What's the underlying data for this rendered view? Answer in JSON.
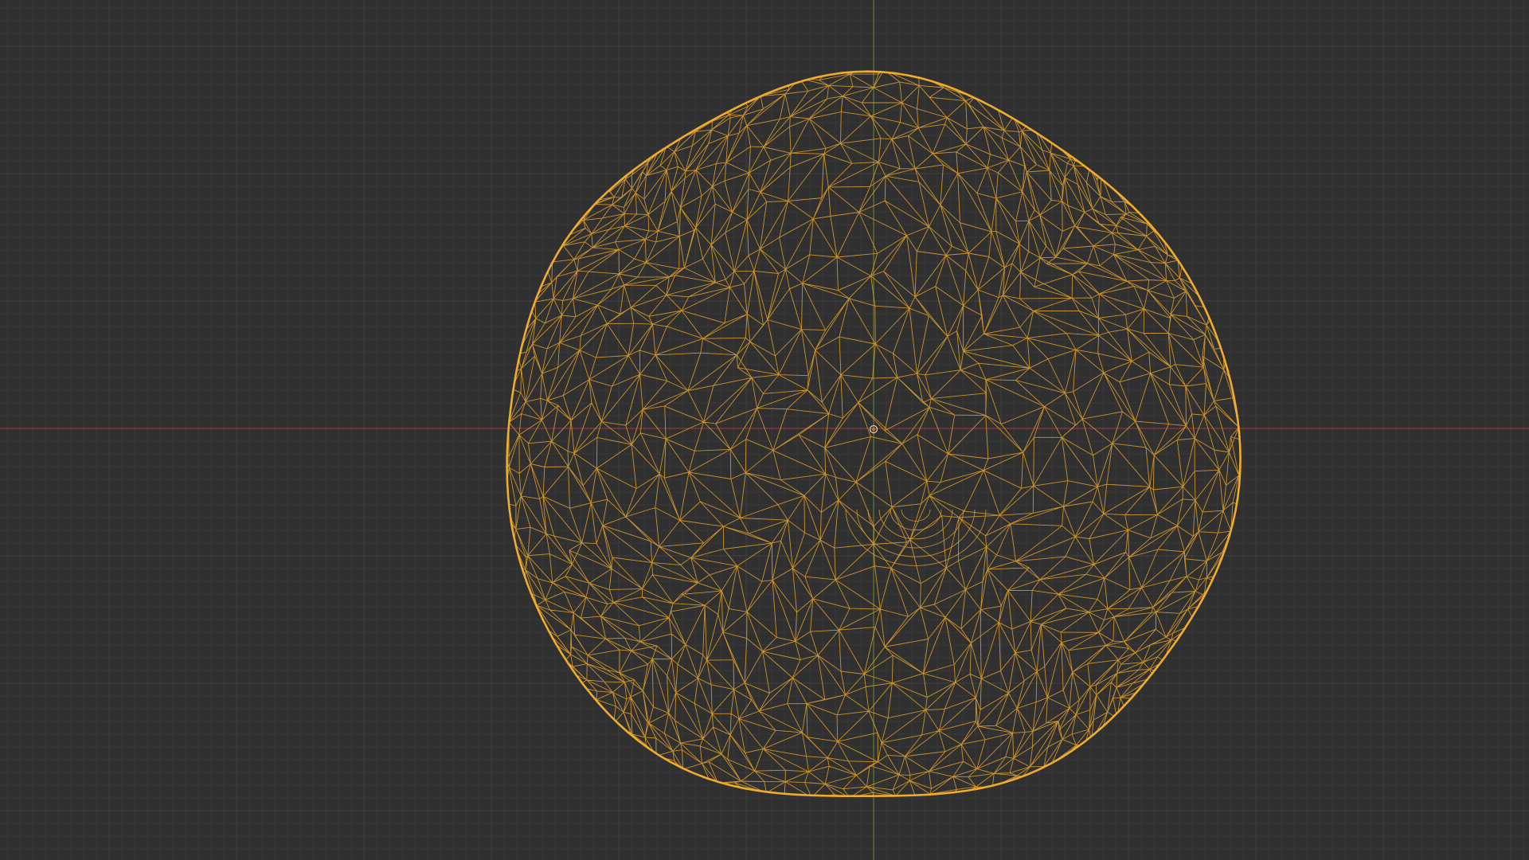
{
  "viewport": {
    "mode": "wireframe",
    "grid": true,
    "origin_marker": "object-origin-icon",
    "mesh": {
      "shape": "lumpy sphere (sculpted ball)",
      "wire_color": "#e8a32a",
      "outline_color": "#f0ac2c"
    },
    "axes": {
      "x_axis_color": "#8a3b3b",
      "y_axis_color": "#5e7d35"
    },
    "colors": {
      "background": "#303030",
      "grid_minor": "#383838",
      "grid_major": "#404040"
    }
  }
}
